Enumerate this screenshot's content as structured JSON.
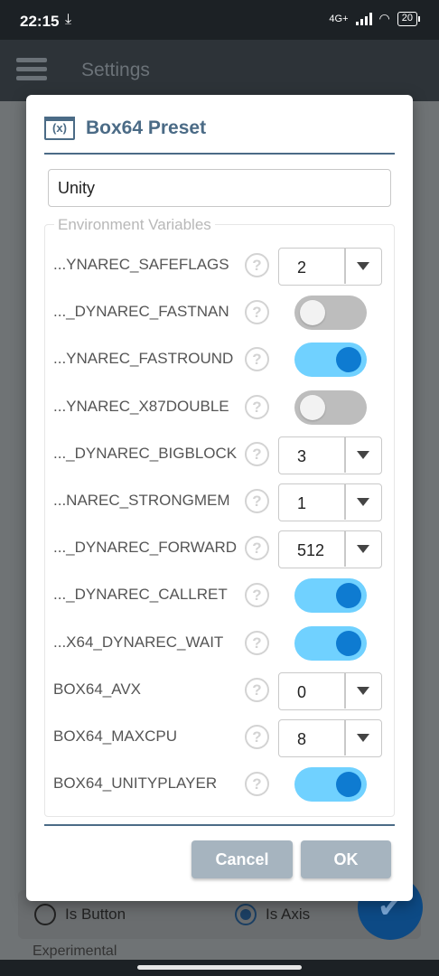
{
  "status_bar": {
    "time": "22:15",
    "network": "4G+",
    "battery": "20"
  },
  "app_bar": {
    "title": "Settings",
    "menu_icon": "menu-icon"
  },
  "background": {
    "radio_button_label": "Is Button",
    "radio_axis_label": "Is Axis",
    "experimental_label": "Experimental",
    "fab_icon": "check-icon"
  },
  "dialog": {
    "icon": "variable-icon",
    "icon_text": "(x)",
    "title": "Box64 Preset",
    "name_value": "Unity",
    "env_legend": "Environment Variables",
    "rows": [
      {
        "label": "...YNAREC_SAFEFLAGS",
        "kind": "select",
        "value": "2"
      },
      {
        "label": "..._DYNAREC_FASTNAN",
        "kind": "toggle",
        "checked": false
      },
      {
        "label": "...YNAREC_FASTROUND",
        "kind": "toggle",
        "checked": true
      },
      {
        "label": "...YNAREC_X87DOUBLE",
        "kind": "toggle",
        "checked": false
      },
      {
        "label": "..._DYNAREC_BIGBLOCK",
        "kind": "select",
        "value": "3"
      },
      {
        "label": "...NAREC_STRONGMEM",
        "kind": "select",
        "value": "1"
      },
      {
        "label": "..._DYNAREC_FORWARD",
        "kind": "select",
        "value": "512"
      },
      {
        "label": "..._DYNAREC_CALLRET",
        "kind": "toggle",
        "checked": true
      },
      {
        "label": "...X64_DYNAREC_WAIT",
        "kind": "toggle",
        "checked": true
      },
      {
        "label": "BOX64_AVX",
        "kind": "select",
        "value": "0"
      },
      {
        "label": "BOX64_MAXCPU",
        "kind": "select",
        "value": "8"
      },
      {
        "label": "BOX64_UNITYPLAYER",
        "kind": "toggle",
        "checked": true
      }
    ],
    "help_glyph": "?",
    "cancel_label": "Cancel",
    "ok_label": "OK"
  },
  "colors": {
    "accent": "#4b6b86",
    "toggle_on": "#70d1ff",
    "knob_on": "#0e7bd1",
    "button": "#a6b4bf"
  }
}
